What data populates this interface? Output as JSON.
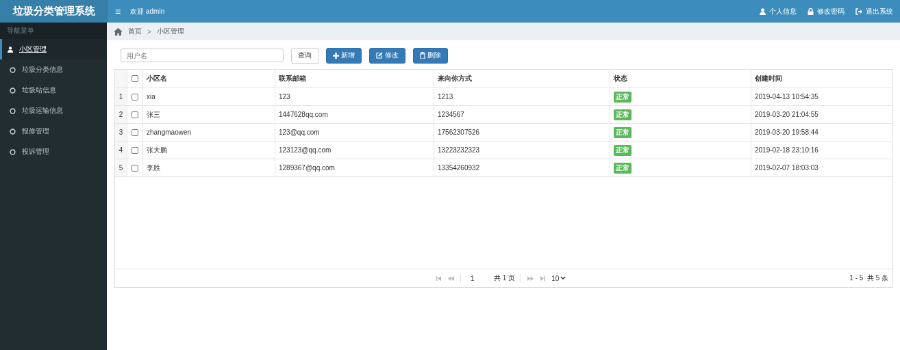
{
  "header": {
    "logo": "垃圾分类管理系统",
    "menu_toggle": "≡",
    "welcome": "欢迎 admin",
    "links": [
      {
        "kind": "user",
        "label": "个人信息"
      },
      {
        "kind": "lock",
        "label": "修改密码"
      },
      {
        "kind": "exit",
        "label": "退出系统"
      }
    ]
  },
  "sidebar": {
    "heading": "导航菜单",
    "items": [
      {
        "label": "小区管理",
        "selected": true
      },
      {
        "label": "垃圾分类信息",
        "selected": false
      },
      {
        "label": "垃圾站信息",
        "selected": false
      },
      {
        "label": "垃圾运输信息",
        "selected": false
      },
      {
        "label": "报修管理",
        "selected": false
      },
      {
        "label": "投诉管理",
        "selected": false
      }
    ]
  },
  "breadcrumb": [
    "首页",
    "小区管理"
  ],
  "breadcrumb_separator": ">",
  "toolbar": {
    "search": {
      "placeholder": "用户名"
    },
    "buttons": [
      {
        "kind": "query",
        "label": "查询"
      },
      {
        "kind": "add",
        "label": "新增"
      },
      {
        "kind": "edit",
        "label": "修改"
      },
      {
        "kind": "delete",
        "label": "删除"
      }
    ]
  },
  "table": {
    "columns": [
      "小区名",
      "联系邮箱",
      "来向你方式",
      "状态",
      "创建时间"
    ],
    "header_checked": false,
    "rows": [
      {
        "index": "1",
        "checked": false,
        "cells": [
          "xia",
          "123",
          "1213",
          "正常",
          "2019-04-13 10:54:35"
        ]
      },
      {
        "index": "2",
        "checked": false,
        "cells": [
          "张三",
          "1447628qq.com",
          "1234567",
          "正常",
          "2019-03-20 21:04:55"
        ]
      },
      {
        "index": "3",
        "checked": false,
        "cells": [
          "zhangmaowen",
          "123@qq.com",
          "17562307526",
          "正常",
          "2019-03-20 19:58:44"
        ]
      },
      {
        "index": "4",
        "checked": false,
        "cells": [
          "张大鹏",
          "123123@qq.com",
          "13223232323",
          "正常",
          "2019-02-18 23:10:16"
        ]
      },
      {
        "index": "5",
        "checked": false,
        "cells": [
          "李胜",
          "1289367@qq.com",
          "13354260932",
          "正常",
          "2019-02-07 18:03:03"
        ]
      }
    ]
  },
  "pager": {
    "page": "1",
    "total_pages": "共 1 页",
    "page_size": "10",
    "summary": "1 - 5  共 5 条"
  }
}
